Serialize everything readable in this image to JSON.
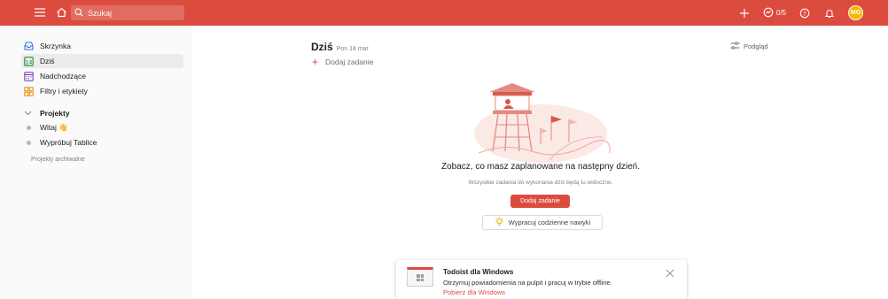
{
  "colors": {
    "accent": "#db4c3f",
    "sidebar_bg": "#fafafa"
  },
  "topbar": {
    "icons": [
      "menu-icon",
      "home-icon",
      "search-icon",
      "plus-icon",
      "karma-icon",
      "help-icon",
      "bell-icon"
    ],
    "search": {
      "placeholder": "Szukaj"
    },
    "karma": "0/5",
    "avatar_initials": "MG"
  },
  "sidebar": {
    "items": [
      {
        "label": "Skrzynka",
        "icon": "inbox-icon"
      },
      {
        "label": "Dziś",
        "icon": "calendar-today-icon",
        "active": true
      },
      {
        "label": "Nadchodzące",
        "icon": "calendar-upcoming-icon"
      },
      {
        "label": "Filtry i etykiety",
        "icon": "filters-labels-icon"
      }
    ],
    "projects_heading": "Projekty",
    "projects": [
      {
        "label": "Witaj 👋"
      },
      {
        "label": "Wypróbuj Tablice"
      }
    ],
    "archived_label": "Projekty archiwalne"
  },
  "main": {
    "title": "Dziś",
    "date": "Pon 14 mar",
    "view_label": "Podgląd",
    "add_task_label": "Dodaj zadanie",
    "empty_title": "Zobacz, co masz zaplanowane na następny dzień.",
    "empty_subtitle": "Wszystkie zadania do wykonania dziś będą tu widoczne.",
    "add_button_label": "Dodaj zadanie",
    "habit_button_label": "Wypracuj codzienne nawyki"
  },
  "toast": {
    "title": "Todoist dla Windows",
    "body": "Otrzymuj powiadomienia na pulpit i pracuj w trybie offline.",
    "link": "Pobierz dla Windows"
  }
}
